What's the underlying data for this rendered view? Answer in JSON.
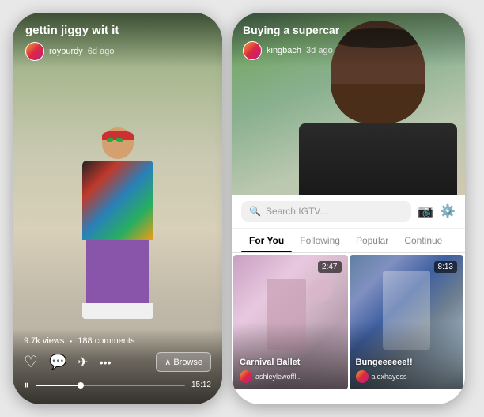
{
  "left_phone": {
    "title": "gettin jiggy wit it",
    "user": "roypurdy",
    "user_age": "6d ago",
    "views": "9.7k views",
    "comments": "188 comments",
    "duration": "15:12",
    "browse_label": "Browse",
    "progress_percent": 30
  },
  "right_phone": {
    "title": "Buying a supercar",
    "user": "kingbach",
    "user_age": "3d ago",
    "search_placeholder": "Search IGTV...",
    "tabs": [
      {
        "label": "For You",
        "active": true
      },
      {
        "label": "Following",
        "active": false
      },
      {
        "label": "Popular",
        "active": false
      },
      {
        "label": "Continue",
        "active": false
      }
    ],
    "videos": [
      {
        "title": "Carnival Ballet",
        "username": "ashleylewoffl...",
        "duration": "2:47"
      },
      {
        "title": "Bungeeeeee!!",
        "username": "alexhayess",
        "duration": "8:13"
      }
    ]
  }
}
